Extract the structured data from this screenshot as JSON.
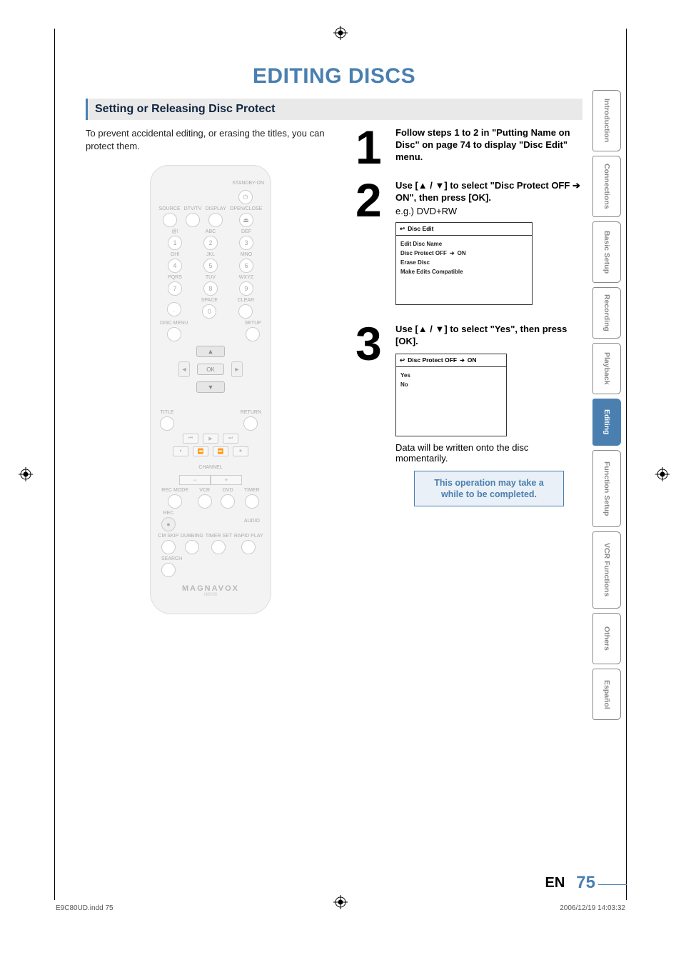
{
  "title": "EDITING DISCS",
  "section_bar": "Setting or Releasing Disc Protect",
  "intro": "To prevent accidental editing, or erasing the titles, you can protect them.",
  "remote": {
    "standby": "STANDBY-ON",
    "row1": [
      "SOURCE",
      "DTV/TV",
      "DISPLAY",
      "OPEN/CLOSE"
    ],
    "digits": [
      "1",
      "2",
      "3",
      "4",
      "5",
      "6",
      "7",
      "8",
      "9",
      ".",
      "0",
      ""
    ],
    "digit_labels": [
      "@!",
      "ABC",
      "DEF",
      "GHI",
      "JKL",
      "MNO",
      "PQRS",
      "TUV",
      "WXYZ",
      "",
      "SPACE",
      "CLEAR"
    ],
    "disc_menu": "DISC MENU",
    "setup": "SETUP",
    "ok": "OK",
    "title_label": "TITLE",
    "return_label": "RETURN",
    "channel": "CHANNEL",
    "bottom_row1": [
      "REC MODE",
      "VCR",
      "DVD",
      "TIMER"
    ],
    "bottom_row2a": "REC",
    "bottom_row2b": "AUDIO",
    "bottom_row3": [
      "CM SKIP",
      "DUBBING",
      "TIMER SET",
      "RAPID PLAY"
    ],
    "search": "SEARCH",
    "brand": "MAGNAVOX",
    "brand_sub": "NB095"
  },
  "steps": {
    "s1": {
      "n": "1",
      "text": "Follow steps 1 to 2 in \"Putting Name on Disc\" on page 74 to display \"Disc Edit\" menu."
    },
    "s2": {
      "n": "2",
      "head_a": "Use [",
      "head_b": " / ",
      "head_c": "] to select \"Disc Protect OFF ",
      "head_d": " ON\", then press [OK].",
      "sub": "e.g.) DVD+RW",
      "osd_title": "Disc Edit",
      "osd_items": {
        "a": "Edit Disc Name",
        "b_pre": "Disc Protect OFF",
        "b_post": "ON",
        "c": "Erase Disc",
        "d": "Make Edits Compatible"
      }
    },
    "s3": {
      "n": "3",
      "head_a": "Use [",
      "head_b": " / ",
      "head_c": "] to select \"Yes\", then press [OK].",
      "osd_title_pre": "Disc Protect OFF",
      "osd_title_post": "ON",
      "osd_items": {
        "yes": "Yes",
        "no": "No"
      },
      "note": "Data will be written onto the disc momentarily.",
      "box": "This operation may take a while to be completed."
    }
  },
  "tabs": [
    "Introduction",
    "Connections",
    "Basic Setup",
    "Recording",
    "Playback",
    "Editing",
    "Function Setup",
    "VCR Functions",
    "Others",
    "Español"
  ],
  "footer": {
    "lang": "EN",
    "page": "75"
  },
  "crop": {
    "file": "E9C80UD.indd   75",
    "time": "2006/12/19   14:03:32"
  }
}
